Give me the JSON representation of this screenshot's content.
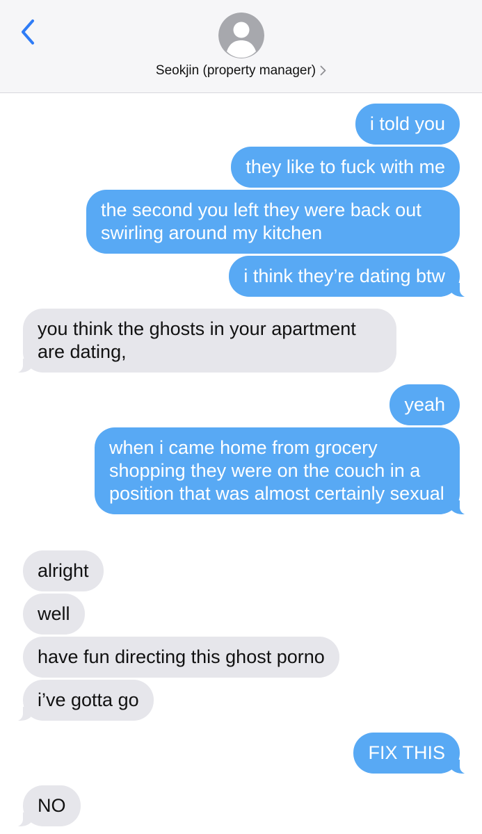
{
  "header": {
    "contact_name": "Seokjin (property manager)"
  },
  "colors": {
    "outgoing_bubble": "#58a9f4",
    "incoming_bubble": "#e6e6eb",
    "accent": "#2f7cf6"
  },
  "messages": [
    {
      "direction": "outgoing",
      "text": "i told you"
    },
    {
      "direction": "outgoing",
      "text": "they like to fuck with me"
    },
    {
      "direction": "outgoing",
      "text": "the second you left they were back out swirling around my kitchen"
    },
    {
      "direction": "outgoing",
      "text": "i think they’re dating btw"
    },
    {
      "direction": "incoming",
      "text": "you think the ghosts in your apartment are dating,"
    },
    {
      "direction": "outgoing",
      "text": "yeah"
    },
    {
      "direction": "outgoing",
      "text": "when i came home from grocery shopping they were on the couch in a position that was almost certainly sexual"
    },
    {
      "direction": "incoming",
      "text": "alright"
    },
    {
      "direction": "incoming",
      "text": "well"
    },
    {
      "direction": "incoming",
      "text": "have fun directing this ghost porno"
    },
    {
      "direction": "incoming",
      "text": "i’ve gotta go"
    },
    {
      "direction": "outgoing",
      "text": "FIX THIS"
    },
    {
      "direction": "incoming",
      "text": "NO"
    }
  ]
}
